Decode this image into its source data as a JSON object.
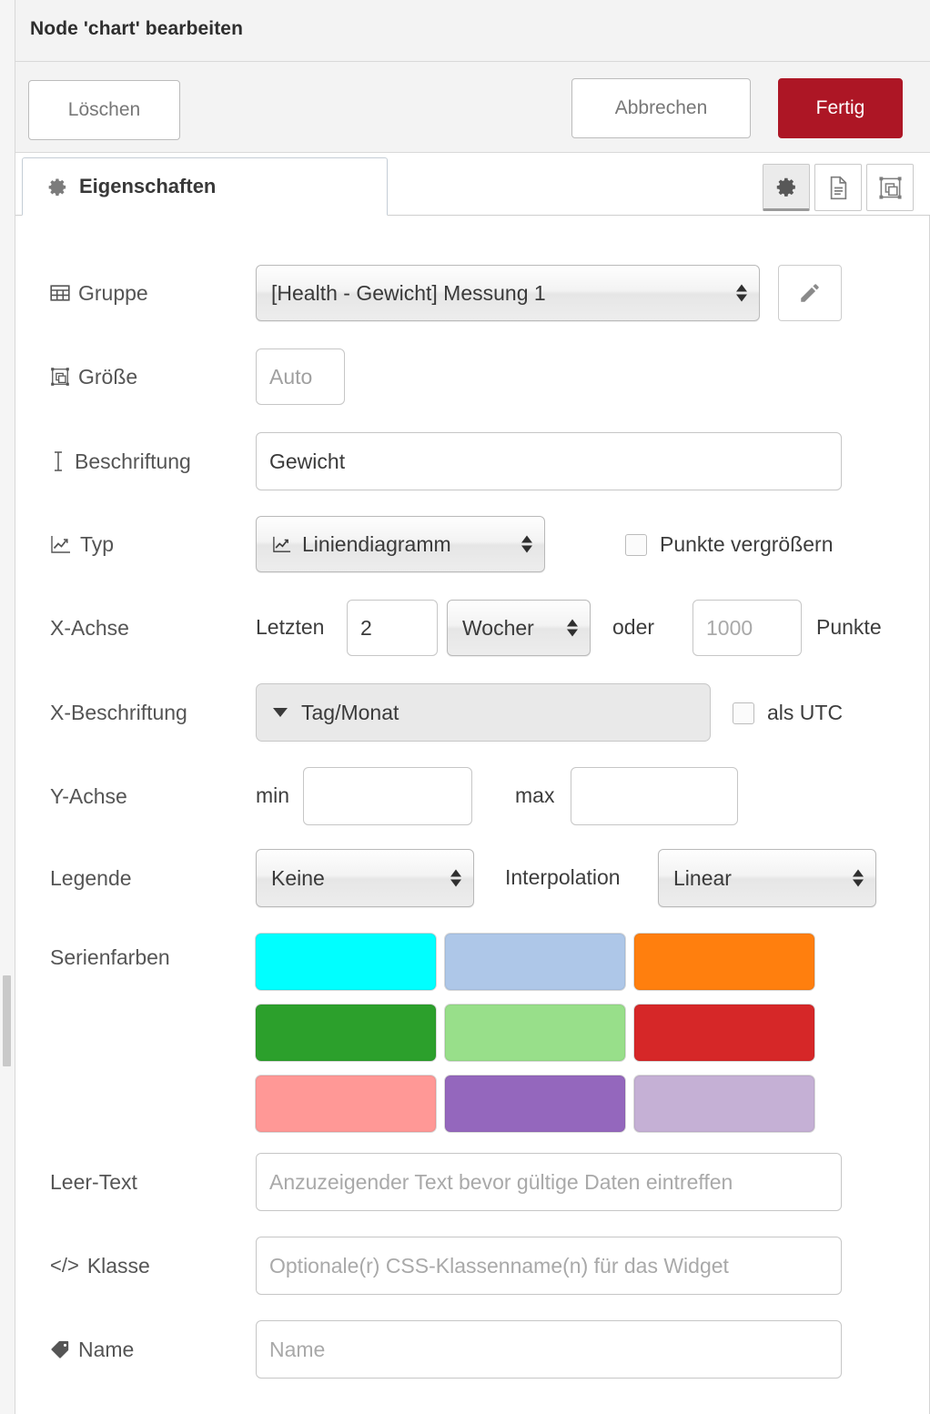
{
  "window": {
    "title": "Node 'chart' bearbeiten"
  },
  "toolbar": {
    "delete_label": "Löschen",
    "cancel_label": "Abbrechen",
    "done_label": "Fertig",
    "done_color": "#ad1625"
  },
  "tabs": {
    "properties_label": "Eigenschaften",
    "icon_buttons": [
      {
        "name": "gear-icon",
        "active": true
      },
      {
        "name": "description-icon",
        "active": false
      },
      {
        "name": "appearance-icon",
        "active": false
      }
    ]
  },
  "form": {
    "group": {
      "label": "Gruppe",
      "icon": "table-icon",
      "value": "[Health - Gewicht] Messung 1",
      "edit_button_icon": "pencil-icon"
    },
    "size": {
      "label": "Größe",
      "icon": "resize-icon",
      "value": "Auto"
    },
    "caption": {
      "label": "Beschriftung",
      "icon": "text-cursor-icon",
      "value": "Gewicht"
    },
    "type": {
      "label": "Typ",
      "icon": "line-chart-icon",
      "value": "Liniendiagramm",
      "enlarge_points_label": "Punkte vergrößern",
      "enlarge_points_checked": false
    },
    "xaxis": {
      "label": "X-Achse",
      "last_label": "Letzten",
      "count_value": "2",
      "unit_value": "Wocher",
      "or_label": "oder",
      "points_placeholder": "1000",
      "points_label": "Punkte"
    },
    "xlabel": {
      "label": "X-Beschriftung",
      "value": "Tag/Monat",
      "utc_label": "als UTC",
      "utc_checked": false
    },
    "yaxis": {
      "label": "Y-Achse",
      "min_label": "min",
      "min_value": "",
      "max_label": "max",
      "max_value": ""
    },
    "legend": {
      "label": "Legende",
      "value": "Keine"
    },
    "interpolation": {
      "label": "Interpolation",
      "value": "Linear"
    },
    "series_colors": {
      "label": "Serienfarben",
      "colors": [
        "#00ffff",
        "#aec7e8",
        "#ff7f0e",
        "#2ca02c",
        "#98df8a",
        "#d62728",
        "#ff9896",
        "#9467bd",
        "#c5b0d5"
      ]
    },
    "empty_text": {
      "label": "Leer-Text",
      "value": "",
      "placeholder": "Anzuzeigender Text bevor gültige Daten eintreffen"
    },
    "css_class": {
      "label": "Klasse",
      "icon": "code-icon",
      "value": "",
      "placeholder": "Optionale(r) CSS-Klassenname(n) für das Widget"
    },
    "name": {
      "label": "Name",
      "icon": "tag-icon",
      "value": "",
      "placeholder": "Name"
    }
  }
}
